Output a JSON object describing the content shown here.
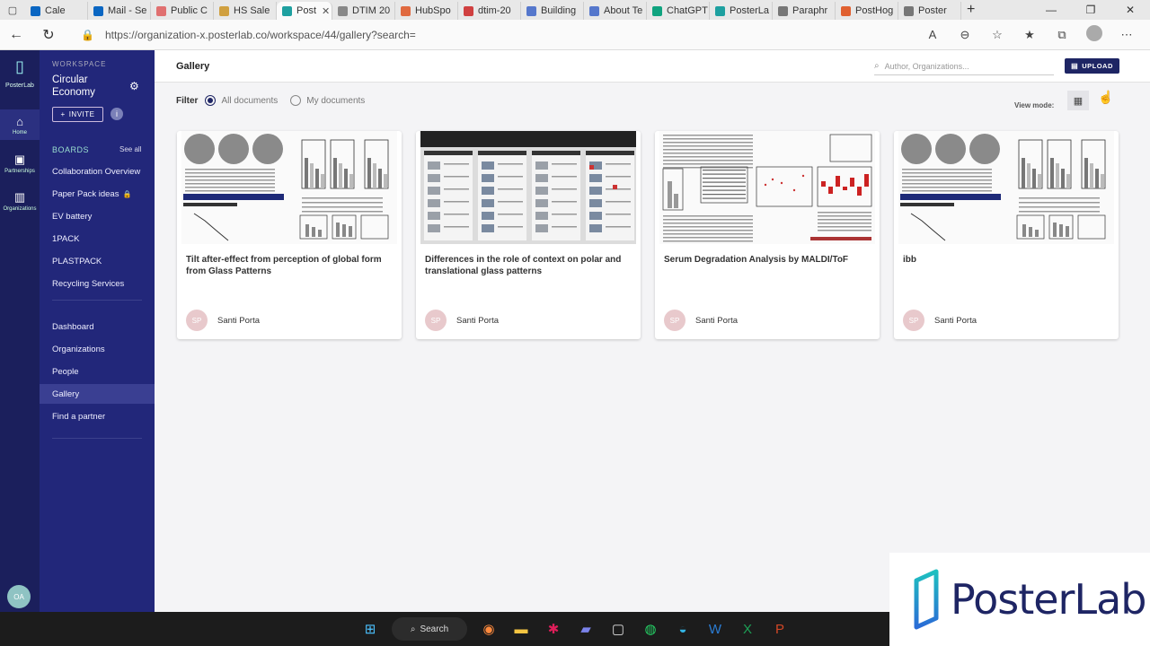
{
  "browser": {
    "tabs": [
      {
        "label": "Cale",
        "color": "#0a66c2"
      },
      {
        "label": "Mail - Se",
        "color": "#0a66c2"
      },
      {
        "label": "Public C",
        "color": "#e07070"
      },
      {
        "label": "HS Sale",
        "color": "#d0a040"
      },
      {
        "label": "Post",
        "color": "#1ea0a0",
        "active": true
      },
      {
        "label": "DTIM 20",
        "color": "#888888"
      },
      {
        "label": "HubSpo",
        "color": "#e06a40"
      },
      {
        "label": "dtim-20",
        "color": "#d04040"
      },
      {
        "label": "Building",
        "color": "#5577cc"
      },
      {
        "label": "About Te",
        "color": "#5577cc"
      },
      {
        "label": "ChatGPT",
        "color": "#10a37f"
      },
      {
        "label": "PosterLa",
        "color": "#1ea0a0"
      },
      {
        "label": "Paraphr",
        "color": "#777777"
      },
      {
        "label": "PostHog",
        "color": "#e06030"
      },
      {
        "label": "Poster",
        "color": "#777777"
      }
    ],
    "url": "https://organization-x.posterlab.co/workspace/44/gallery?search="
  },
  "rail": {
    "logo_label": "PosterLab",
    "items": [
      {
        "label": "Home",
        "icon": "home-icon",
        "glyph": "⌂"
      },
      {
        "label": "Partnerships",
        "icon": "briefcase-icon",
        "glyph": "▣"
      },
      {
        "label": "Organizations",
        "icon": "building-icon",
        "glyph": "▥"
      }
    ],
    "user_initials": "OA"
  },
  "sidebar": {
    "workspace_label": "WORKSPACE",
    "workspace_name": "Circular Economy",
    "invite_label": "INVITE",
    "boards_label": "BOARDS",
    "see_all": "See all",
    "boards": [
      {
        "label": "Collaboration Overview"
      },
      {
        "label": "Paper Pack ideas",
        "locked": true
      },
      {
        "label": "EV battery"
      },
      {
        "label": "1PACK"
      },
      {
        "label": "PLASTPACK"
      },
      {
        "label": "Recycling Services"
      }
    ],
    "nav": [
      {
        "label": "Dashboard"
      },
      {
        "label": "Organizations"
      },
      {
        "label": "People"
      },
      {
        "label": "Gallery",
        "active": true
      },
      {
        "label": "Find a partner"
      }
    ]
  },
  "main": {
    "title": "Gallery",
    "search_placeholder": "Author, Organizations...",
    "upload_label": "UPLOAD",
    "filter_label": "Filter",
    "filter_options": [
      {
        "label": "All documents",
        "selected": true
      },
      {
        "label": "My documents",
        "selected": false
      }
    ],
    "view_mode_label": "View mode:"
  },
  "cards": [
    {
      "title": "Tilt after-effect from perception of global form from Glass Patterns",
      "author": "Santi Porta",
      "initials": "SP"
    },
    {
      "title": "Differences in the role of context on polar and translational glass patterns",
      "author": "Santi Porta",
      "initials": "SP"
    },
    {
      "title": "Serum Degradation Analysis by MALDI/ToF",
      "author": "Santi Porta",
      "initials": "SP"
    },
    {
      "title": "ibb",
      "author": "Santi Porta",
      "initials": "SP"
    }
  ],
  "taskbar": {
    "search_label": "Search"
  },
  "watermark": {
    "brand": "PosterLab"
  },
  "colors": {
    "sidebar_bg": "#22277a",
    "rail_bg": "#1b1f5c",
    "accent": "#1e2564",
    "teal": "#1ea0a0"
  }
}
